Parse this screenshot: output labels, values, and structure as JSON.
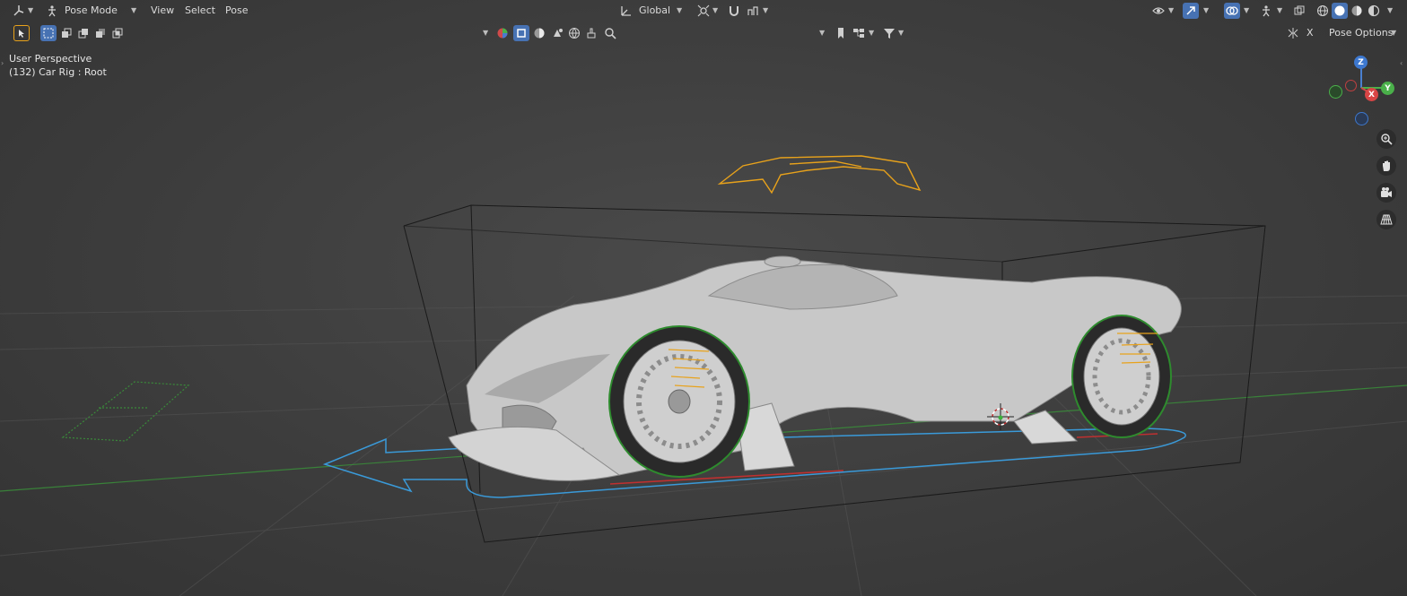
{
  "header": {
    "mode_label": "Pose Mode",
    "menus": [
      "View",
      "Select",
      "Pose"
    ],
    "transform_orientation": "Global",
    "pose_options_label": "Pose Options",
    "x_mirror_label": "X"
  },
  "overlay": {
    "view_name": "User Perspective",
    "object_info": "(132) Car Rig : Root"
  },
  "gizmo": {
    "z": "Z",
    "y": "Y",
    "x": "X"
  },
  "colors": {
    "accent": "#4772b3",
    "bone_orange": "#e8a21b",
    "rig_blue": "#3a9ad9",
    "wheel_green": "#2e8b2e",
    "axis_red": "#c03030",
    "axis_green": "#3a8a3a"
  },
  "icons": {
    "editor_type": "object-axes-icon",
    "mode": "pose-mode-icon",
    "select_box": "select-box-icon",
    "transform_orientation": "axis-orientation-icon",
    "pivot": "pivot-point-icon",
    "snap": "magnet-snap-icon",
    "proportional": "proportional-edit-icon",
    "visibility": "eye-visibility-icon",
    "gizmo_toggle": "gizmo-arrow-icon",
    "overlays": "overlays-icon",
    "armature": "armature-icon",
    "xray": "xray-icon",
    "shading": [
      "wireframe-shading-icon",
      "solid-shading-icon",
      "material-shading-icon",
      "rendered-shading-icon"
    ],
    "zoom": "zoom-magnifier-icon",
    "pan": "pan-hand-icon",
    "camera": "camera-view-icon",
    "ortho": "perspective-grid-icon"
  }
}
